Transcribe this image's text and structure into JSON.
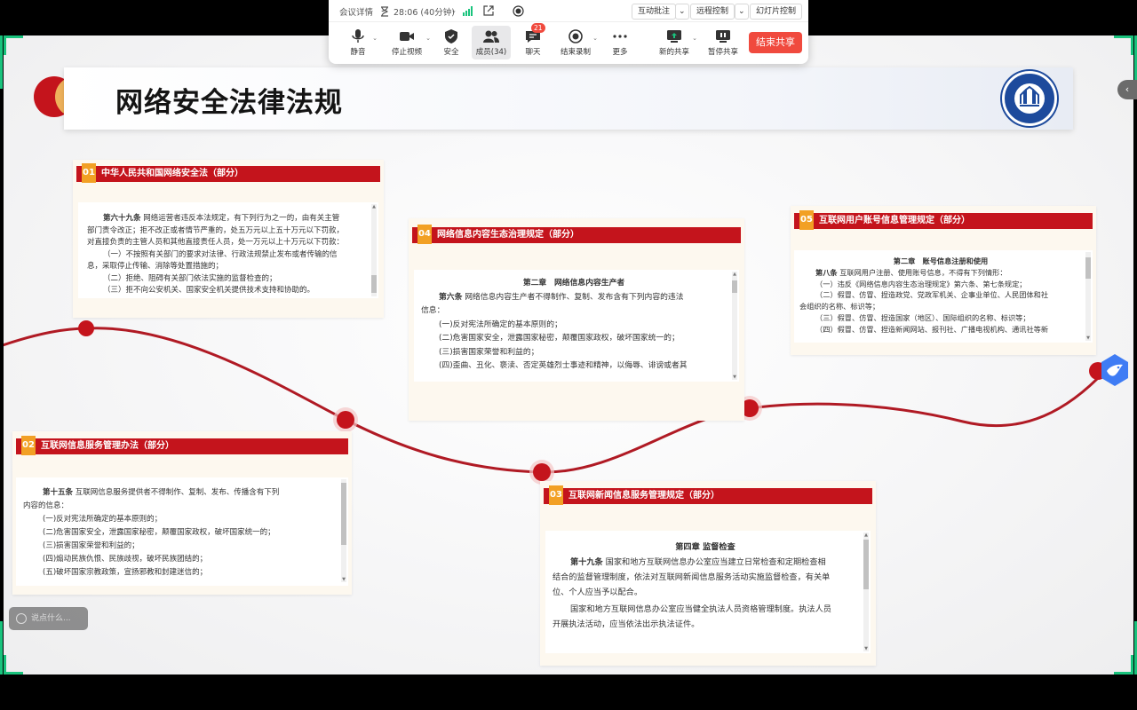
{
  "toolbar": {
    "meeting_details": "会议详情",
    "duration": "28:06 (40分钟)",
    "interactive_annotate": "互动批注",
    "remote_control": "远程控制",
    "slideshow_control": "幻灯片控制",
    "buttons": {
      "mute": "静音",
      "stop_video": "停止视频",
      "security": "安全",
      "members": "成员(34)",
      "chat": "聊天",
      "chat_badge": "21",
      "end_record": "结束录制",
      "more": "更多",
      "new_share": "新的共享",
      "pause_share": "暂停共享"
    },
    "end_share": "结束共享"
  },
  "slide": {
    "title": "网络安全法律法规",
    "logo_text": "XIANGTAN UNIVERSITY",
    "logo_year": "1958"
  },
  "cards": [
    {
      "num": "01",
      "title": "中华人民共和国网络安全法（部分）",
      "lines": [
        "第六十九条",
        "网络运营者违反本法规定，有下列行为之一的，由有关主管",
        "部门责令改正；拒不改正或者情节严重的，处五万元以上五十万元以下罚款，",
        "对直接负责的主管人员和其他直接责任人员，处一万元以上十万元以下罚款：",
        "（一）不按照有关部门的要求对法律、行政法规禁止发布或者传输的信",
        "息，采取停止传输、消除等处置措施的；",
        "（二）拒绝、阻碍有关部门依法实施的监督检查的；",
        "（三）拒不向公安机关、国家安全机关提供技术支持和协助的。"
      ]
    },
    {
      "num": "02",
      "title": "互联网信息服务管理办法（部分）",
      "lines": [
        "第十五条",
        "互联网信息服务提供者不得制作、复制、发布、传播含有下列",
        "内容的信息：",
        "(一)反对宪法所确定的基本原则的；",
        "(二)危害国家安全，泄露国家秘密，颠覆国家政权，破坏国家统一的；",
        "(三)损害国家荣誉和利益的；",
        "(四)煽动民族仇恨、民族歧视，破坏民族团结的；",
        "(五)破坏国家宗教政策，宣扬邪教和封建迷信的；"
      ]
    },
    {
      "num": "03",
      "title": "互联网新闻信息服务管理规定（部分）",
      "lines": [
        "第四章 监督检查",
        "第十九条",
        "国家和地方互联网信息办公室应当建立日常检查和定期检查相",
        "结合的监督管理制度，依法对互联网新闻信息服务活动实施监督检查，有关单",
        "位、个人应当予以配合。",
        "国家和地方互联网信息办公室应当健全执法人员资格管理制度。执法人员",
        "开展执法活动，应当依法出示执法证件。"
      ]
    },
    {
      "num": "04",
      "title": "网络信息内容生态治理规定（部分）",
      "lines": [
        "第二章　网络信息内容生产者",
        "第六条",
        "网络信息内容生产者不得制作、复制、发布含有下列内容的违法",
        "信息：",
        "(一)反对宪法所确定的基本原则的；",
        "(二)危害国家安全，泄露国家秘密，颠覆国家政权，破坏国家统一的；",
        "(三)损害国家荣誉和利益的；",
        "(四)歪曲、丑化、亵渎、否定英雄烈士事迹和精神，以侮辱、诽谤或者其"
      ]
    },
    {
      "num": "05",
      "title": "互联网用户账号信息管理规定（部分）",
      "lines": [
        "第二章　账号信息注册和使用",
        "第八条",
        "互联网用户注册、使用账号信息，不得有下列情形：",
        "（一）违反《网络信息内容生态治理规定》第六条、第七条规定；",
        "（二）假冒、仿冒、捏造政党、党政军机关、企事业单位、人民团体和社",
        "会组织的名称、标识等；",
        "（三）假冒、仿冒、捏造国家（地区）、国际组织的名称、标识等；",
        "（四）假冒、仿冒、捏造新闻网站、报刊社、广播电视机构、通讯社等新"
      ]
    }
  ],
  "chat_input_placeholder": "说点什么...",
  "colors": {
    "accent_red": "#c4141c",
    "number_orange": "#f2a024",
    "end_share_red": "#f04a3e",
    "share_border_green": "#19c37d"
  }
}
